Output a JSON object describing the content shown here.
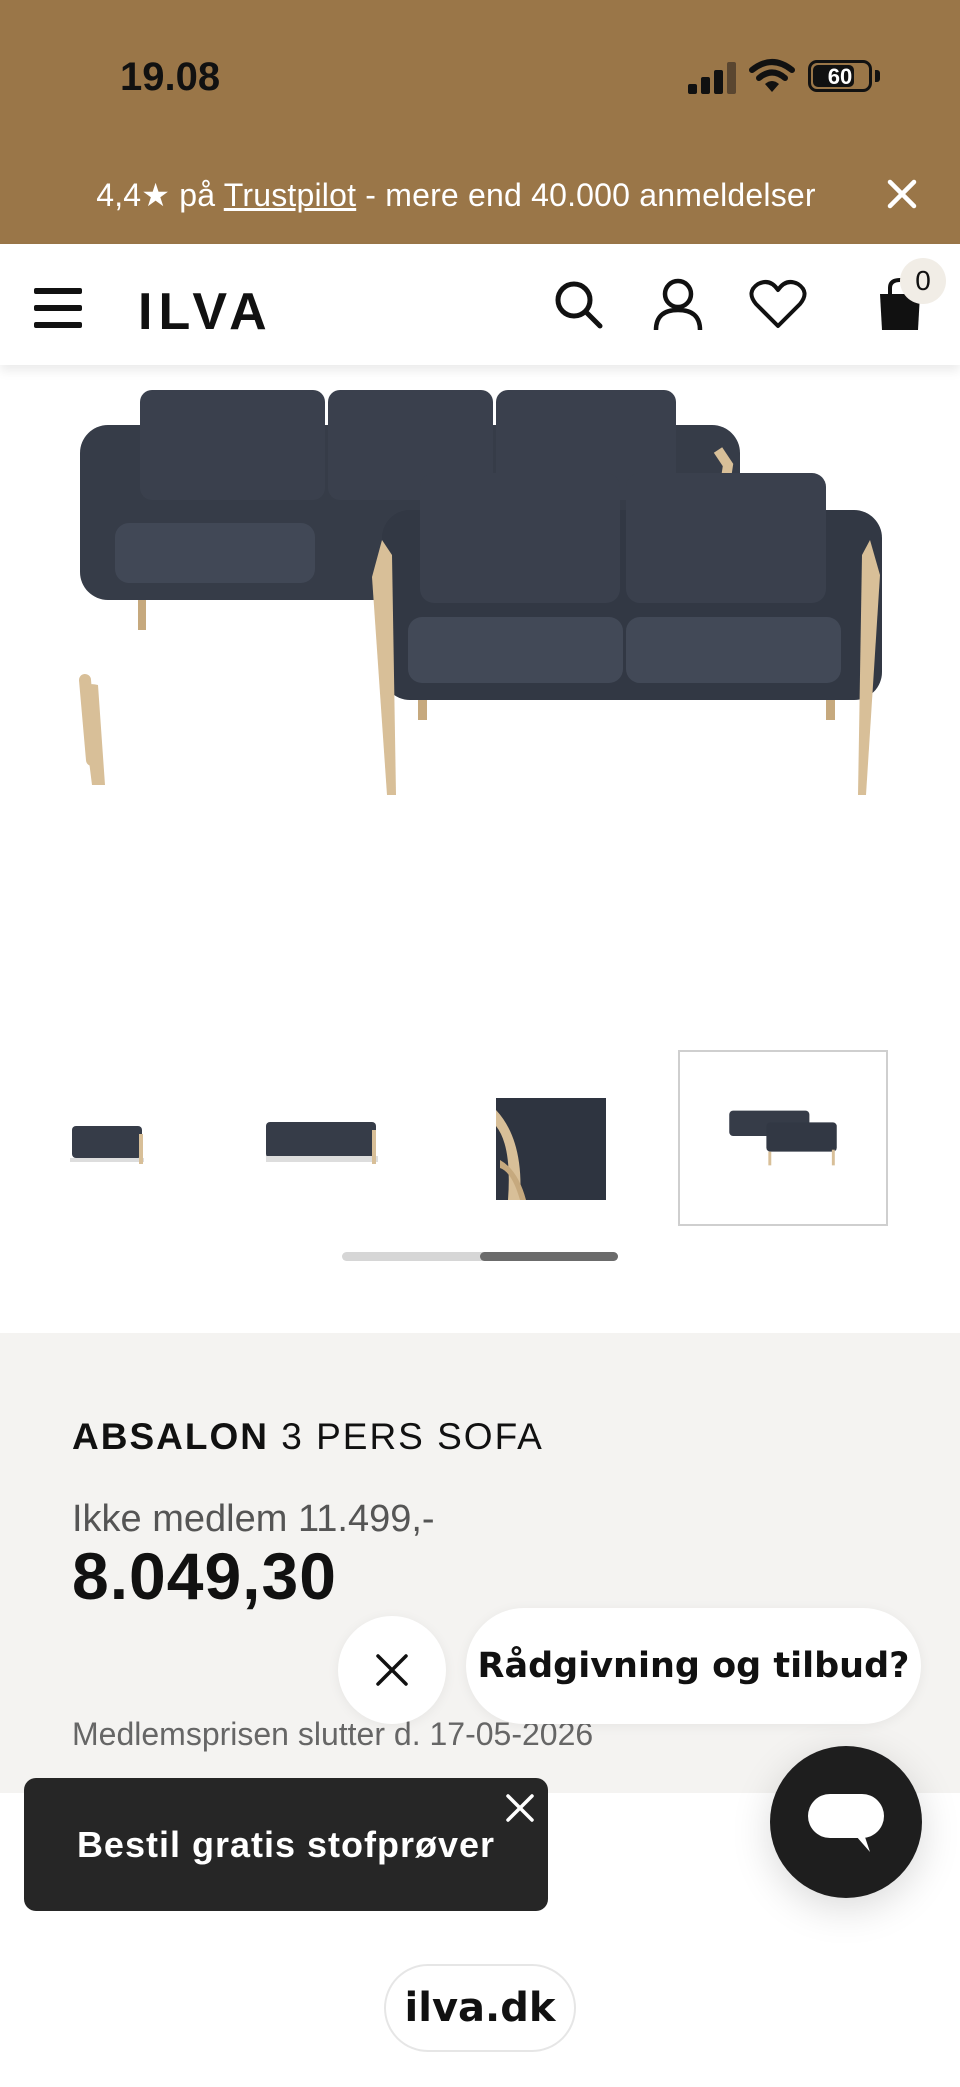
{
  "status_bar": {
    "time": "19.08",
    "battery": "60"
  },
  "promo": {
    "prefix": "4,4★ på ",
    "link": "Trustpilot",
    "suffix": " - mere end 40.000 anmeldelser"
  },
  "header": {
    "logo": "ILVA",
    "cart_count": "0"
  },
  "product": {
    "brand": "ABSALON",
    "name": " 3 PERS SOFA",
    "old_price": "Ikke medlem 11.499,-",
    "member_price": "8.049,30",
    "member_ends": "Medlemsprisen slutter d. 17-05-2026"
  },
  "chat": {
    "prompt": "Rådgivning og tilbud?"
  },
  "fabric_toast": {
    "label": "Bestil gratis stofprøver"
  },
  "browser": {
    "url": "ilva.dk"
  },
  "colors": {
    "banner": "#9a7648",
    "sofa": "#363c48",
    "wood": "#d8bf98",
    "panel": "#f4f3f1",
    "dark": "#262626"
  }
}
